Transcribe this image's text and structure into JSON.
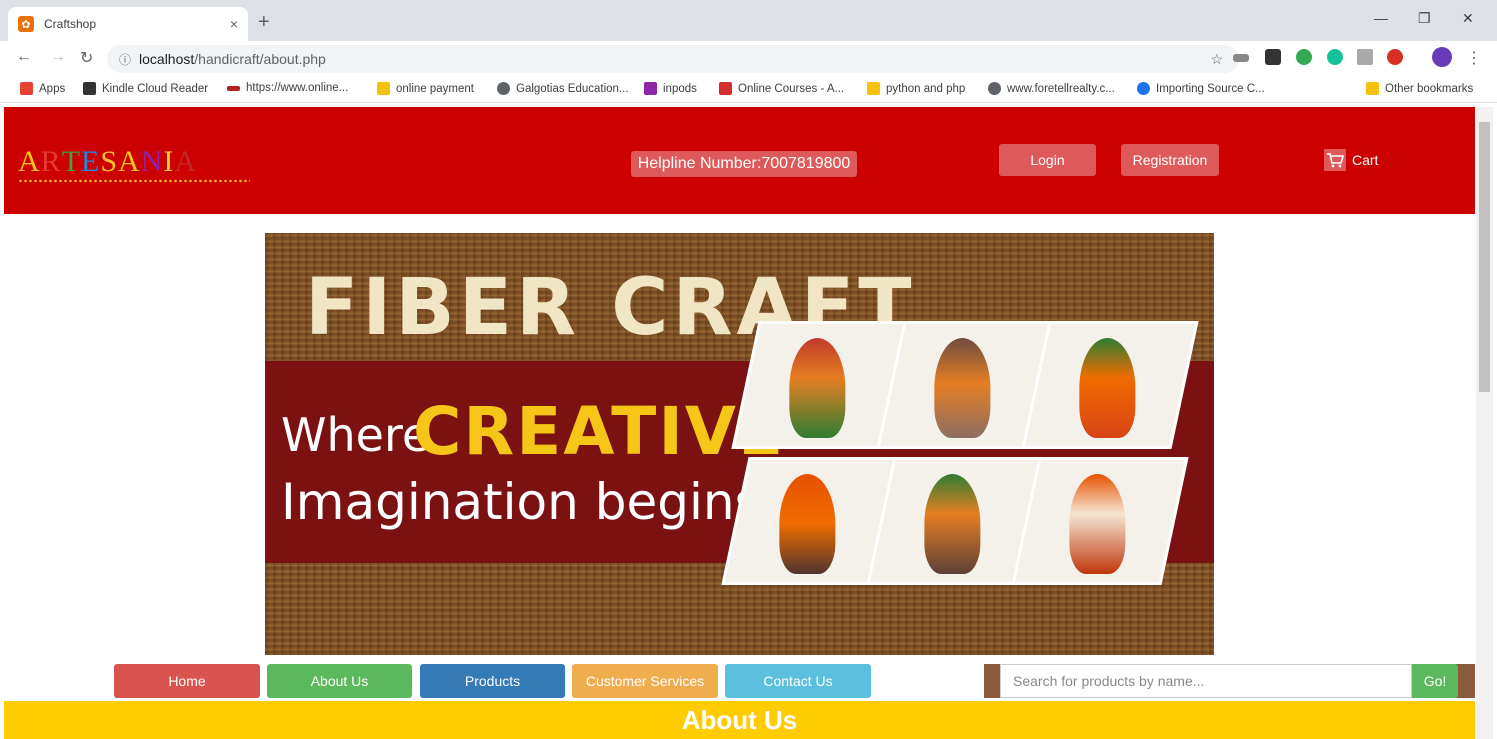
{
  "browser": {
    "tab_title": "Craftshop",
    "tab_close": "×",
    "new_tab": "+",
    "url_host": "localhost",
    "url_path": "/handicraft/about.php",
    "window_controls": [
      "—",
      "❐",
      "✕"
    ]
  },
  "bookmarks": [
    {
      "label": "Apps",
      "color": "#e94235"
    },
    {
      "label": "Kindle Cloud Reader",
      "color": "#333333"
    },
    {
      "label": "https://www.online...",
      "color": "#b22222"
    },
    {
      "label": "online payment",
      "color": "#f4c20d"
    },
    {
      "label": "Galgotias Education...",
      "color": "#5f6368"
    },
    {
      "label": "inpods",
      "color": "#8e24aa"
    },
    {
      "label": "Online Courses - A...",
      "color": "#d32f2f"
    },
    {
      "label": "python and php",
      "color": "#f4c20d"
    },
    {
      "label": "www.foretellrealty.c...",
      "color": "#5f6368"
    },
    {
      "label": "Importing Source C...",
      "color": "#1a73e8"
    },
    {
      "label": "Other bookmarks",
      "color": "#f4c20d"
    }
  ],
  "site": {
    "logo_letters": [
      {
        "ch": "A",
        "color": "#f5c518"
      },
      {
        "ch": "R",
        "color": "#e53935"
      },
      {
        "ch": "T",
        "color": "#43a047"
      },
      {
        "ch": "E",
        "color": "#1e88e5"
      },
      {
        "ch": "S",
        "color": "#fbc02d"
      },
      {
        "ch": "A",
        "color": "#f5c518"
      },
      {
        "ch": "N",
        "color": "#8e24aa"
      },
      {
        "ch": "I",
        "color": "#fdd835"
      },
      {
        "ch": "A",
        "color": "#c62828"
      }
    ],
    "helpline": "Helpline Number:7007819800",
    "login": "Login",
    "registration": "Registration",
    "cart": "Cart"
  },
  "banner": {
    "headline": "FIBER CRAFT",
    "where": "Where",
    "creative": "CREATIVE",
    "imagination": "Imagination begins"
  },
  "nav": {
    "home": "Home",
    "about": "About Us",
    "products": "Products",
    "customer_services": "Customer Services",
    "contact": "Contact Us",
    "search_placeholder": "Search for products by name...",
    "go": "Go!"
  },
  "colors": {
    "header_red": "#cc0000",
    "home": "#d9534f",
    "about": "#5cb85c",
    "products": "#337ab7",
    "customer_services": "#f0ad4e",
    "contact": "#5bc0de",
    "about_bar": "#ffcc00"
  },
  "section_title": "About Us"
}
